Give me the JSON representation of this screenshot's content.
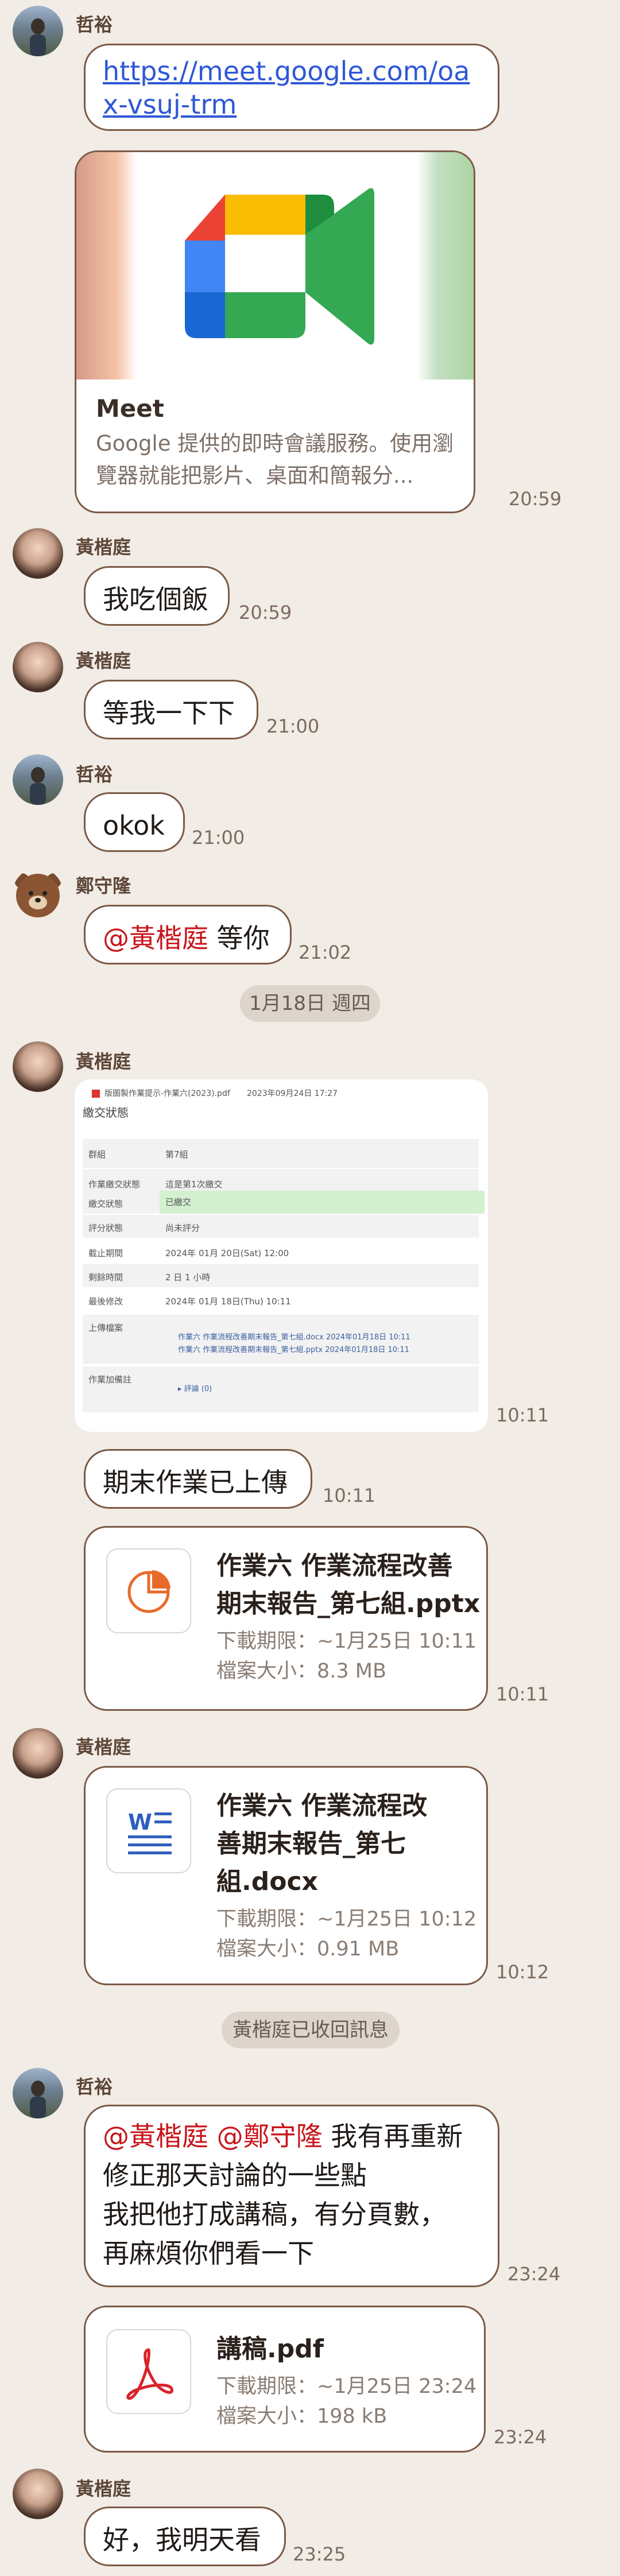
{
  "messages": [
    {
      "sender": "哲裕",
      "link_text": "https://meet.google.com/oax-vsuj-trm",
      "preview": {
        "title": "Meet",
        "desc": "Google 提供的即時會議服務。使用瀏覽器就能把影片、桌面和簡報分...",
        "icon": "google-meet-icon"
      },
      "time": "20:59"
    },
    {
      "sender": "黃楷庭",
      "text": "我吃個飯",
      "time": "20:59"
    },
    {
      "sender": "黃楷庭",
      "text": "等我一下下",
      "time": "21:00"
    },
    {
      "sender": "哲裕",
      "text": "okok",
      "time": "21:00"
    },
    {
      "sender": "鄭守隆",
      "mention": "@黃楷庭",
      "text": " 等你",
      "time": "21:02"
    }
  ],
  "date_separator": "1月18日 週四",
  "screenshot_msg": {
    "sender": "黃楷庭",
    "time": "10:11",
    "doc": {
      "header_file": "版圖製作業提示-作業六(2023).pdf",
      "header_date": "2023年09月24日 17:27",
      "heading": "繳交狀態",
      "rows": [
        {
          "k": "群組",
          "v": "第7組"
        },
        {
          "k": "作業繳交狀態",
          "v": "這是第1次繳交"
        },
        {
          "k": "繳交狀態",
          "v": "已繳交"
        },
        {
          "k": "評分狀態",
          "v": "尚未評分"
        },
        {
          "k": "截止期間",
          "v": "2024年 01月 20日(Sat) 12:00"
        },
        {
          "k": "剩餘時間",
          "v": "2 日 1 小時"
        },
        {
          "k": "最後修改",
          "v": "2024年 01月 18日(Thu) 10:11"
        },
        {
          "k": "上傳檔案",
          "v": "作業六 作業流程改善期末報告_第七組.docx 2024年01月18日 10:11"
        },
        {
          "k": "",
          "v": "作業六 作業流程改善期末報告_第七組.pptx 2024年01月18日 10:11"
        },
        {
          "k": "作業加備註",
          "v": "▸ 評論 (0)"
        }
      ]
    }
  },
  "upload_msg": {
    "text": "期末作業已上傳",
    "time": "10:11"
  },
  "file1": {
    "name": "作業六 作業流程改善期末報告_第七組.pptx",
    "line1": "作業六 作業流程改善",
    "line2": "期末報告_第七組.pptx",
    "expiry": "下載期限：~1月25日 10:11",
    "size": "檔案大小：8.3 MB",
    "time": "10:11",
    "icon": "pptx-icon"
  },
  "file2": {
    "sender": "黃楷庭",
    "line1": "作業六 作業流程改",
    "line2": "善期末報告_第七",
    "line3": "組.docx",
    "expiry": "下載期限：~1月25日 10:12",
    "size": "檔案大小：0.91 MB",
    "time": "10:12",
    "icon": "docx-icon"
  },
  "recall_notice": "黃楷庭已收回訊息",
  "long_msg": {
    "sender": "哲裕",
    "mention1": "@黃楷庭",
    "mention2": "@鄭守隆",
    "l1_rest": " 我有再重新",
    "l2": "修正那天討論的一些點",
    "l3": "我把他打成講稿，有分頁數，",
    "l4": "再麻煩你們看一下",
    "time": "23:24"
  },
  "file3": {
    "name": "講稿.pdf",
    "expiry": "下載期限：~1月25日 23:24",
    "size": "檔案大小：198 kB",
    "time": "23:24",
    "icon": "pdf-icon"
  },
  "last_msg": {
    "sender": "黃楷庭",
    "text": "好，我明天看",
    "time": "23:25"
  },
  "colors": {
    "bubble_border": "#7b5a46",
    "background": "#f1ece5",
    "mention": "#c8151b",
    "link": "#2e58d6"
  }
}
